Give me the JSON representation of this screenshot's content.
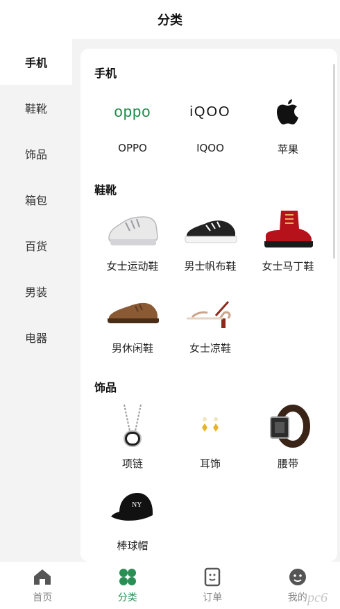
{
  "header": {
    "title": "分类"
  },
  "sidebar": {
    "items": [
      {
        "label": "手机",
        "active": true
      },
      {
        "label": "鞋靴"
      },
      {
        "label": "饰品"
      },
      {
        "label": "箱包"
      },
      {
        "label": "百货"
      },
      {
        "label": "男装"
      },
      {
        "label": "电器"
      }
    ]
  },
  "sections": {
    "phones": {
      "title": "手机",
      "items": [
        {
          "label": "OPPO",
          "logo": "oppo"
        },
        {
          "label": "IQOO",
          "logo": "iqoo"
        },
        {
          "label": "苹果",
          "icon": "apple-logo-icon"
        }
      ]
    },
    "shoes": {
      "title": "鞋靴",
      "items": [
        {
          "label": "女士运动鞋",
          "icon": "sneaker-icon"
        },
        {
          "label": "男士帆布鞋",
          "icon": "canvas-shoe-icon"
        },
        {
          "label": "女士马丁鞋",
          "icon": "boot-icon"
        },
        {
          "label": "男休闲鞋",
          "icon": "loafer-icon"
        },
        {
          "label": "女士凉鞋",
          "icon": "sandal-icon"
        }
      ]
    },
    "accessories": {
      "title": "饰品",
      "items": [
        {
          "label": "项链",
          "icon": "necklace-icon"
        },
        {
          "label": "耳饰",
          "icon": "earring-icon"
        },
        {
          "label": "腰带",
          "icon": "belt-icon"
        },
        {
          "label": "棒球帽",
          "icon": "cap-icon"
        }
      ]
    }
  },
  "brand_logos": {
    "oppo": "oppo",
    "iqoo": "iQOO"
  },
  "tabbar": {
    "items": [
      {
        "label": "首页",
        "icon": "home-icon"
      },
      {
        "label": "分类",
        "icon": "category-icon",
        "active": true
      },
      {
        "label": "订单",
        "icon": "order-icon"
      },
      {
        "label": "我的",
        "icon": "profile-icon"
      }
    ]
  },
  "watermark": "pc6",
  "colors": {
    "accent": "#2a8f55",
    "oppo_green": "#1f8a4a",
    "inactive": "#888888"
  }
}
